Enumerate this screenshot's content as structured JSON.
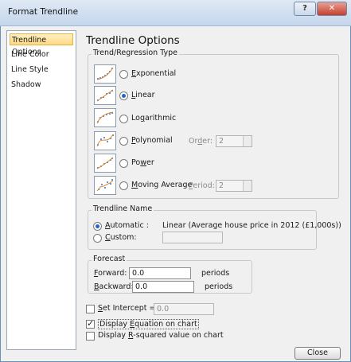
{
  "window": {
    "title": "Format Trendline"
  },
  "titlebar_buttons": {
    "help_label": "?",
    "close_label": "✕"
  },
  "nav": [
    {
      "label": "Trendline Options",
      "active": true
    },
    {
      "label": "Line Color"
    },
    {
      "label": "Line Style"
    },
    {
      "label": "Shadow"
    }
  ],
  "panel_title": "Trendline Options",
  "trend_type": {
    "group_label": "Trend/Regression Type",
    "options": [
      {
        "label": "Exponential",
        "selected": false,
        "icon": "exponential-trend-icon"
      },
      {
        "label": "Linear",
        "selected": true,
        "icon": "linear-trend-icon"
      },
      {
        "label": "Logarithmic",
        "selected": false,
        "icon": "logarithmic-trend-icon"
      },
      {
        "label": "Polynomial",
        "selected": false,
        "icon": "polynomial-trend-icon"
      },
      {
        "label": "Power",
        "selected": false,
        "icon": "power-trend-icon"
      },
      {
        "label": "Moving Average",
        "selected": false,
        "icon": "moving-average-trend-icon"
      }
    ],
    "order_label": "Order:",
    "order_value": "2",
    "period_label": "Period:",
    "period_value": "2"
  },
  "trendline_name": {
    "group_label": "Trendline Name",
    "automatic_label": "Automatic :",
    "automatic_value": "Linear (Average house price in 2012 (£1,000s))",
    "custom_label": "Custom:",
    "custom_value": "",
    "selected": "automatic"
  },
  "forecast": {
    "group_label": "Forecast",
    "forward_label": "Forward:",
    "forward_value": "0.0",
    "backward_label": "Backward:",
    "backward_value": "0.0",
    "unit": "periods"
  },
  "set_intercept": {
    "label": "Set Intercept =",
    "checked": false,
    "value": "0.0"
  },
  "display_equation": {
    "label": "Display Equation on chart",
    "checked": true
  },
  "display_rsquared": {
    "label": "Display R-squared value on chart",
    "checked": false
  },
  "close_button": "Close"
}
